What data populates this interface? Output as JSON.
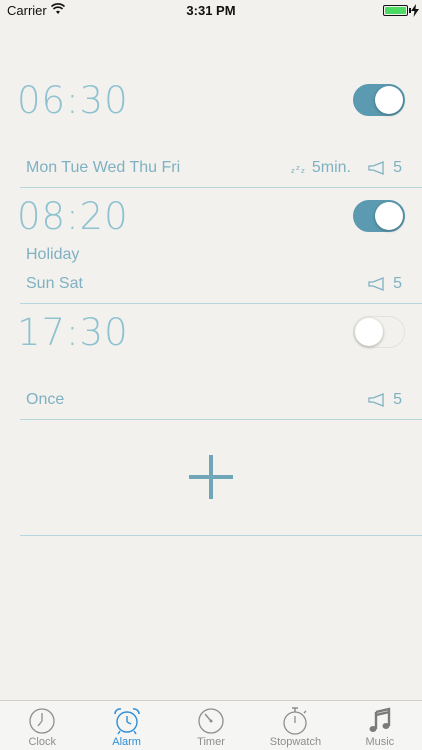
{
  "status_bar": {
    "carrier": "Carrier",
    "time": "3:31 PM",
    "battery_level": 1.0,
    "battery_color": "#4cd964"
  },
  "alarms": [
    {
      "time": "06:30",
      "label": "",
      "days": "Mon Tue Wed Thu Fri",
      "snooze": "5min.",
      "volume": "5",
      "enabled": true
    },
    {
      "time": "08:20",
      "label": "Holiday",
      "days": "Sun Sat",
      "snooze": "",
      "volume": "5",
      "enabled": true
    },
    {
      "time": "17:30",
      "label": "",
      "days": "Once",
      "snooze": "",
      "volume": "5",
      "enabled": false
    }
  ],
  "add_button": {
    "icon": "plus-icon"
  },
  "tabs": [
    {
      "label": "Clock",
      "icon": "clock-icon",
      "active": false
    },
    {
      "label": "Alarm",
      "icon": "alarm-clock-icon",
      "active": true
    },
    {
      "label": "Timer",
      "icon": "timer-icon",
      "active": false
    },
    {
      "label": "Stopwatch",
      "icon": "stopwatch-icon",
      "active": false
    },
    {
      "label": "Music",
      "icon": "music-note-icon",
      "active": false
    }
  ],
  "colors": {
    "accent": "#5b9ab0",
    "text": "#7fb1c2",
    "tab_active": "#2e8fd8",
    "tab_inactive": "#8e8e8e",
    "background": "#f2f1ed"
  }
}
